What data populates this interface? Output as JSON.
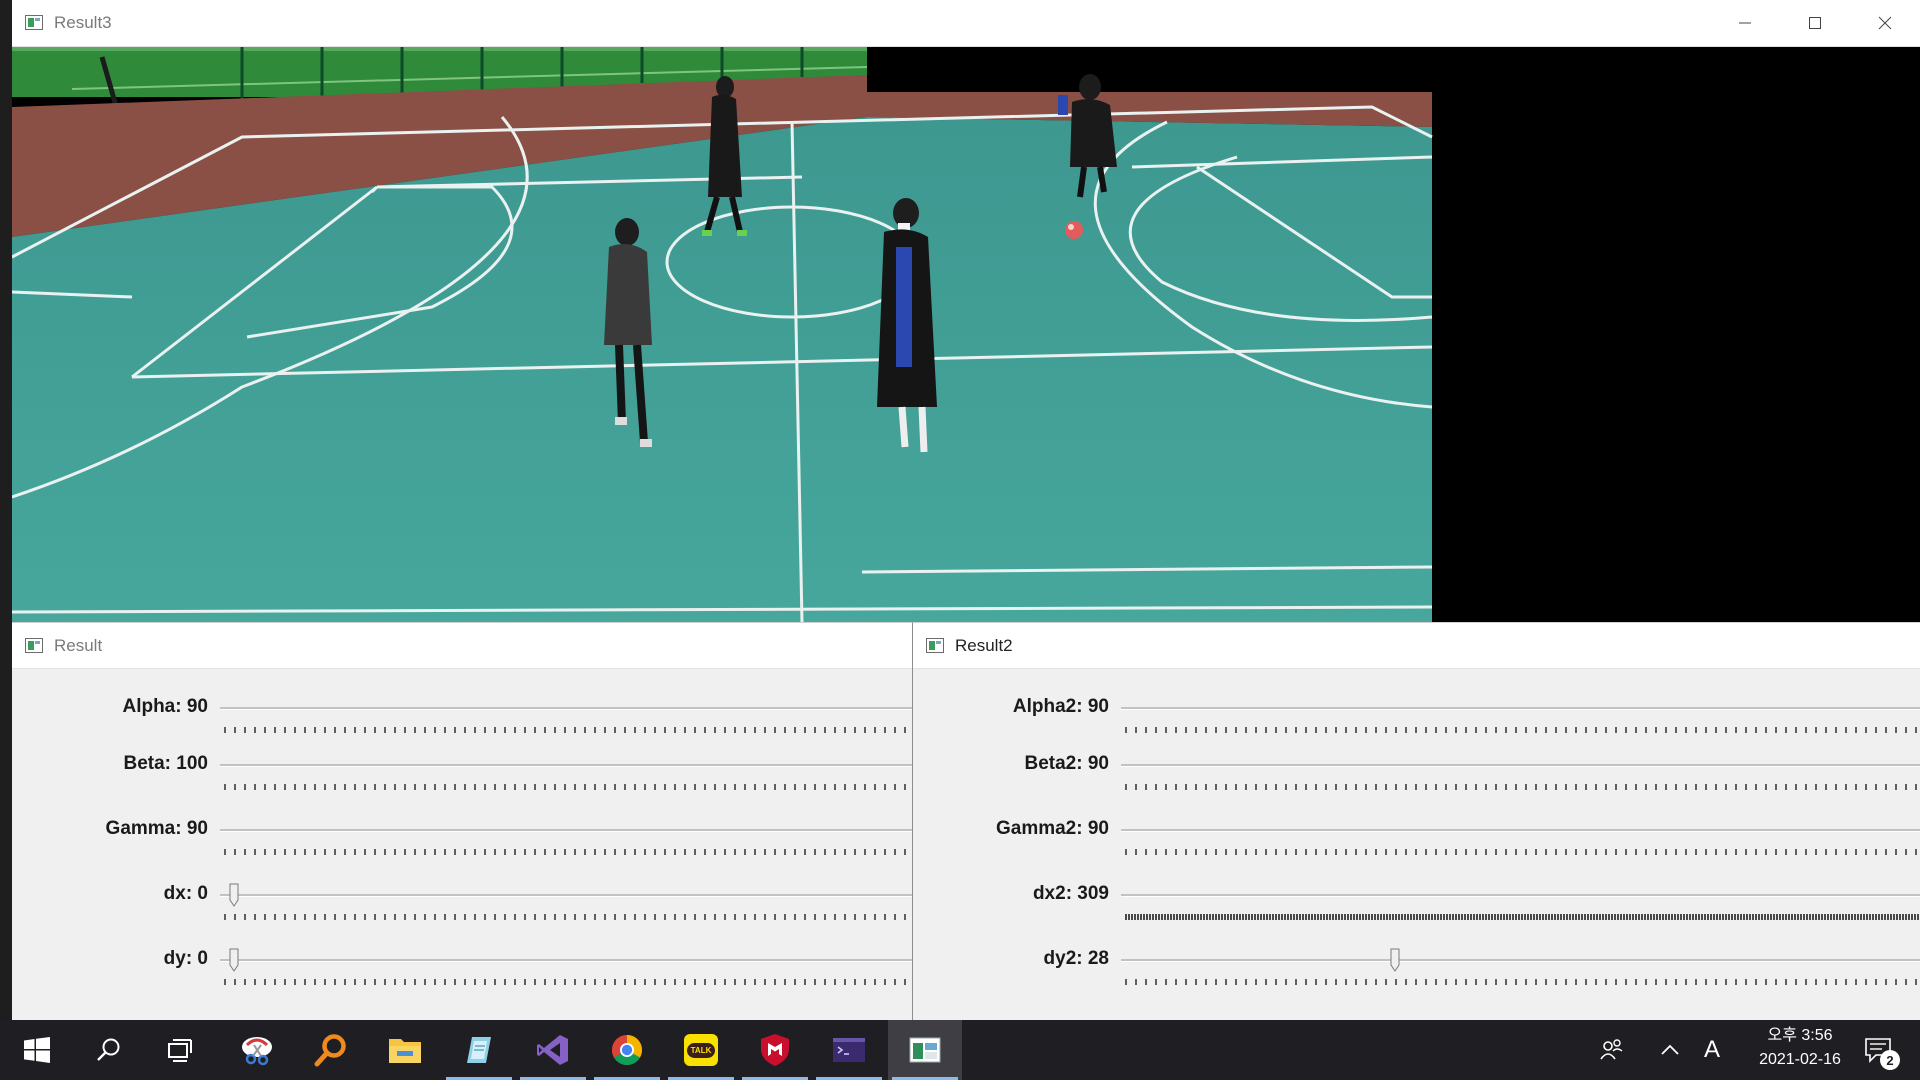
{
  "windows": {
    "result3": {
      "title": "Result3"
    },
    "result": {
      "title": "Result",
      "sliders": [
        {
          "label": "Alpha: 90",
          "value": 90,
          "dense": false
        },
        {
          "label": "Beta: 100",
          "value": 100,
          "dense": false
        },
        {
          "label": "Gamma: 90",
          "value": 90,
          "dense": false
        },
        {
          "label": "dx: 0",
          "value": 0,
          "dense": false
        },
        {
          "label": "dy: 0",
          "value": 0,
          "dense": false
        }
      ]
    },
    "result2": {
      "title": "Result2",
      "sliders": [
        {
          "label": "Alpha2: 90",
          "value": 90,
          "dense": false
        },
        {
          "label": "Beta2: 90",
          "value": 90,
          "dense": false
        },
        {
          "label": "Gamma2: 90",
          "value": 90,
          "dense": false
        },
        {
          "label": "dx2: 309",
          "value": 309,
          "dense": true
        },
        {
          "label": "dy2: 28",
          "value": 28,
          "dense": false
        }
      ]
    }
  },
  "taskbar": {
    "items": [
      {
        "name": "start-icon",
        "running": false,
        "active": false
      },
      {
        "name": "search-icon",
        "running": false,
        "active": false
      },
      {
        "name": "task-view-icon",
        "running": false,
        "active": false
      },
      {
        "name": "snip-tool-icon",
        "running": false,
        "active": false
      },
      {
        "name": "magnifier-search-app-icon",
        "running": false,
        "active": false
      },
      {
        "name": "file-explorer-icon",
        "running": false,
        "active": false
      },
      {
        "name": "notepad-app-icon",
        "running": true,
        "active": false
      },
      {
        "name": "visual-studio-icon",
        "running": true,
        "active": false
      },
      {
        "name": "chrome-icon",
        "running": true,
        "active": false
      },
      {
        "name": "kakaotalk-icon",
        "running": true,
        "active": false
      },
      {
        "name": "mcafee-icon",
        "running": true,
        "active": false
      },
      {
        "name": "terminal-icon",
        "running": true,
        "active": false
      },
      {
        "name": "opencv-window-icon",
        "running": true,
        "active": true
      }
    ],
    "kakao_label": "TALK",
    "ime_label": "A",
    "time": "오후 3:56",
    "date": "2021-02-16",
    "notification_count": "2"
  },
  "colors": {
    "court": "#3f9e94",
    "court_lines": "#e9f2f0",
    "turf": "#2f8a3a",
    "track": "#8a4f45",
    "kakao_yellow": "#f9e000",
    "vs_purple": "#7b4fc9",
    "mcafee_red": "#c8102e"
  }
}
